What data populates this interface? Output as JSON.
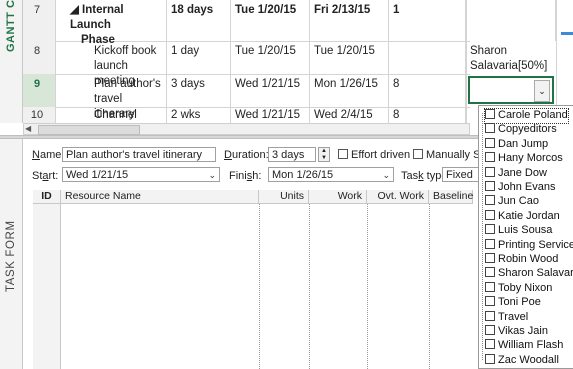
{
  "side": {
    "gantt_label": "GANTT C",
    "taskform_label": "TASK FORM"
  },
  "grid": {
    "rows": [
      {
        "id": "7",
        "name": "◢ Internal Launch Phase",
        "name1": "◢ Internal Launch",
        "name2": "Phase",
        "duration": "18 days",
        "start": "Tue 1/20/15",
        "finish": "Fri 2/13/15",
        "pred": "1",
        "resource1": "",
        "resource2": "",
        "summary": true
      },
      {
        "id": "8",
        "name1": "Kickoff book",
        "name2": "launch meeting",
        "duration": "1 day",
        "start": "Tue 1/20/15",
        "finish": "Tue 1/20/15",
        "pred": "",
        "resource1": "Sharon",
        "resource2": "Salavaria[50%]",
        "summary": false
      },
      {
        "id": "9",
        "name1": "Plan author's",
        "name2": "travel itinerary",
        "duration": "3 days",
        "start": "Wed 1/21/15",
        "finish": "Mon 1/26/15",
        "pred": "8",
        "resource1": "",
        "resource2": "",
        "summary": false,
        "selected": true
      },
      {
        "id": "10",
        "name1": "Channel Sales",
        "name2": "",
        "duration": "2 wks",
        "start": "Wed 1/21/15",
        "finish": "Wed 2/4/15",
        "pred": "8",
        "resource1": "",
        "resource2": "",
        "summary": false
      }
    ]
  },
  "form": {
    "name_label": "Name:",
    "name_value": "Plan author's travel itinerary",
    "duration_label": "Duration:",
    "duration_value": "3 days",
    "effort_label": "Effort driven",
    "manual_label": "Manually S",
    "start_label": "Start:",
    "start_value": "Wed 1/21/15",
    "finish_label": "Finish:",
    "finish_value": "Mon 1/26/15",
    "tasktype_label": "Task type:",
    "tasktype_value": "Fixed",
    "columns": [
      "ID",
      "Resource Name",
      "Units",
      "Work",
      "Ovt. Work",
      "Baseline"
    ]
  },
  "resource_dropdown": {
    "items": [
      "Carole Poland",
      "Copyeditors",
      "Dan Jump",
      "Hany Morcos",
      "Jane Dow",
      "John Evans",
      "Jun Cao",
      "Katie Jordan",
      "Luis Sousa",
      "Printing Service",
      "Robin Wood",
      "Sharon Salavaria",
      "Toby Nixon",
      "Toni Poe",
      "Travel",
      "Vikas Jain",
      "William Flash",
      "Zac Woodall"
    ]
  },
  "colors": {
    "accent": "#217346",
    "border": "#d4d4d4",
    "gantt_bar": "#3c8ad8"
  }
}
